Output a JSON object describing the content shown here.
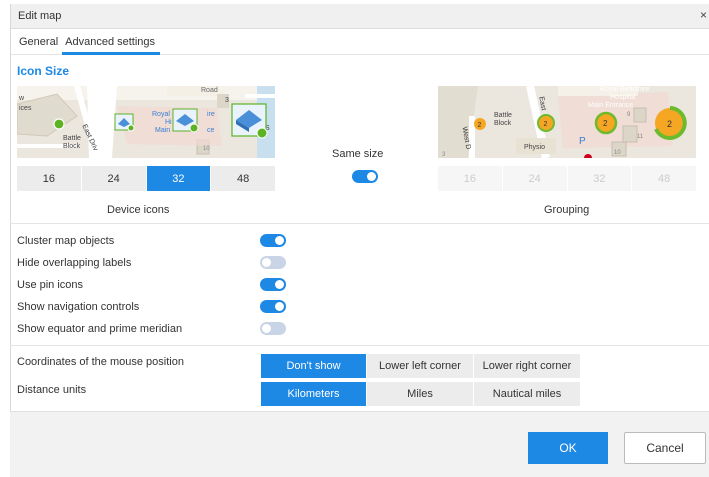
{
  "window": {
    "title": "Edit map",
    "close_glyph": "×"
  },
  "tabs": [
    {
      "label": "General",
      "active": false
    },
    {
      "label": "Advanced settings",
      "active": true
    }
  ],
  "icon_size": {
    "title": "Icon Size",
    "device_sizes": [
      "16",
      "24",
      "32",
      "48"
    ],
    "device_selected": "32",
    "device_caption": "Device icons",
    "same_size_label": "Same size",
    "same_size_on": true,
    "grouping_sizes": [
      "16",
      "24",
      "32",
      "48"
    ],
    "grouping_caption": "Grouping",
    "map_left_labels": [
      "w",
      "ices",
      "Road",
      "3",
      "Royal",
      "ire",
      "Hi",
      "Main",
      "ce",
      "Battle",
      "Block",
      "East Driv",
      "10",
      "S"
    ],
    "map_right_labels": [
      "Royal Berkshire",
      "Hospital",
      "Main Entrance",
      "Battle",
      "Block",
      "East",
      "West D",
      "Physio",
      "P",
      "2",
      "2",
      "2",
      "2",
      "9",
      "11",
      "10",
      "3"
    ]
  },
  "options": [
    {
      "label": "Cluster map objects",
      "on": true
    },
    {
      "label": "Hide overlapping labels",
      "on": false
    },
    {
      "label": "Use pin icons",
      "on": true
    },
    {
      "label": "Show navigation controls",
      "on": true
    },
    {
      "label": "Show equator and prime meridian",
      "on": false
    }
  ],
  "coordinates": {
    "label": "Coordinates of the mouse position",
    "choices": [
      "Don't show",
      "Lower left corner",
      "Lower right corner"
    ],
    "selected": "Don't show"
  },
  "distance": {
    "label": "Distance units",
    "choices": [
      "Kilometers",
      "Miles",
      "Nautical miles"
    ],
    "selected": "Kilometers"
  },
  "footer": {
    "ok_label": "OK",
    "cancel_label": "Cancel"
  },
  "colors": {
    "accent": "#1e88e5",
    "cluster_orange": "#f5a623",
    "cluster_green": "#6dbb2c"
  }
}
